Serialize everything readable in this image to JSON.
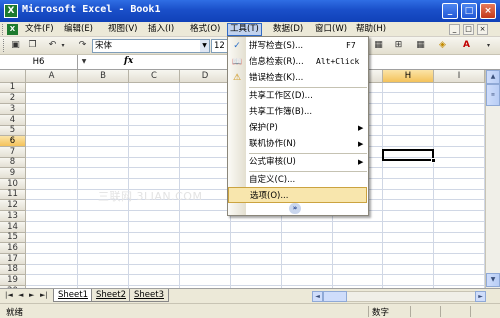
{
  "window": {
    "app_icon": "X",
    "title": "Microsoft Excel - Book1",
    "controls": [
      "_",
      "□",
      "×"
    ]
  },
  "menubar": {
    "items": [
      "文件(F)",
      "编辑(E)",
      "视图(V)",
      "插入(I)",
      "格式(O)",
      "工具(T)",
      "数据(D)",
      "窗口(W)",
      "帮助(H)"
    ],
    "active": "工具(T)",
    "doc_controls": [
      "_",
      "□",
      "×"
    ]
  },
  "toolbar": {
    "font_name": "宋体",
    "font_size": "12"
  },
  "formula_bar": {
    "name_box": "H6",
    "fx_label": "fx",
    "formula": ""
  },
  "sheet": {
    "columns": [
      "A",
      "B",
      "C",
      "D",
      "E",
      "F",
      "G",
      "H",
      "I"
    ],
    "rows": [
      "1",
      "2",
      "3",
      "4",
      "5",
      "6",
      "7",
      "8",
      "9",
      "10",
      "11",
      "12",
      "13",
      "14",
      "15",
      "16",
      "17",
      "18",
      "19",
      "20"
    ],
    "selected_cell": "H6",
    "watermark": "三联网 3LIAN.COM"
  },
  "tools_menu": {
    "items": [
      {
        "label": "拼写检查(S)...",
        "shortcut": "F7",
        "icon": "spellcheck-icon",
        "glyph": "✓"
      },
      {
        "label": "信息检索(R)...",
        "shortcut": "Alt+Click",
        "icon": "research-icon",
        "glyph": "📖"
      },
      {
        "label": "错误检查(K)...",
        "shortcut": "",
        "icon": "error-check-icon",
        "glyph": "⚠"
      },
      {
        "label": "共享工作区(D)...",
        "shortcut": ""
      },
      {
        "label": "共享工作簿(B)...",
        "shortcut": ""
      },
      {
        "label": "保护(P)",
        "submenu": true
      },
      {
        "label": "联机协作(N)",
        "submenu": true
      },
      {
        "label": "公式审核(U)",
        "submenu": true
      },
      {
        "label": "自定义(C)...",
        "shortcut": ""
      },
      {
        "label": "选项(O)...",
        "shortcut": "",
        "highlighted": true
      }
    ],
    "expand_glyph": "»"
  },
  "sheet_tabs": {
    "nav": [
      "|◄",
      "◄",
      "►",
      "►|"
    ],
    "tabs": [
      "Sheet1",
      "Sheet2",
      "Sheet3"
    ],
    "active": "Sheet1"
  },
  "status_bar": {
    "left": "就绪",
    "right": "数字"
  }
}
